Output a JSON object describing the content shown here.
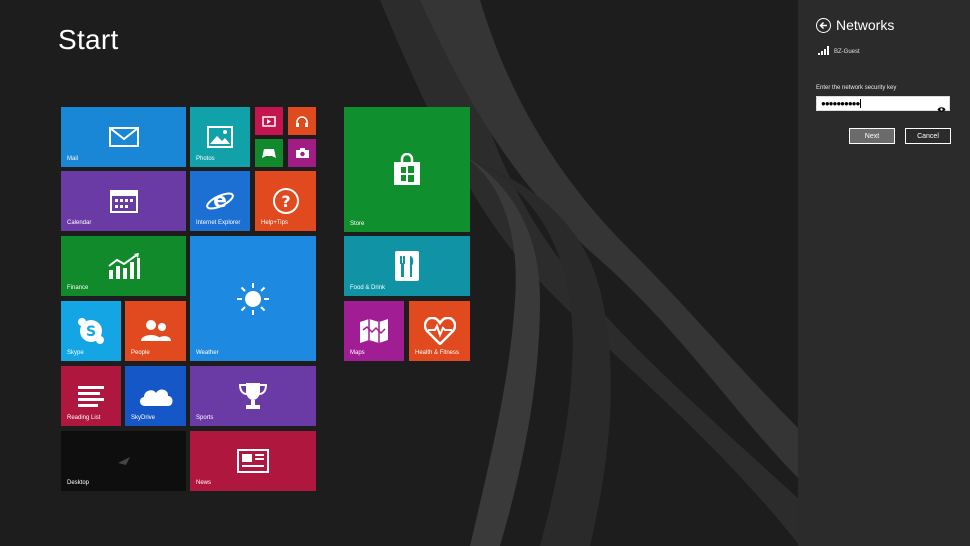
{
  "start": {
    "title": "Start"
  },
  "tiles": {
    "mail": {
      "label": "Mail",
      "icon": "mail-icon",
      "color": "#1a87d6"
    },
    "photos": {
      "label": "Photos",
      "icon": "photos-icon",
      "color": "#11a1a8"
    },
    "video": {
      "label": "",
      "icon": "video-icon",
      "color": "#c4154f"
    },
    "music": {
      "label": "",
      "icon": "headphones-icon",
      "color": "#e04a1f"
    },
    "games": {
      "label": "",
      "icon": "game-controller-icon",
      "color": "#108a2a"
    },
    "camera": {
      "label": "",
      "icon": "camera-icon",
      "color": "#a11d83"
    },
    "calendar": {
      "label": "Calendar",
      "icon": "calendar-icon",
      "color": "#6a3aa5"
    },
    "ie": {
      "label": "Internet Explorer",
      "icon": "internet-explorer-icon",
      "color": "#1c6fd3"
    },
    "help": {
      "label": "Help+Tips",
      "icon": "help-icon",
      "color": "#e14a1f"
    },
    "finance": {
      "label": "Finance",
      "icon": "finance-chart-icon",
      "color": "#108a2a"
    },
    "weather": {
      "label": "Weather",
      "icon": "sun-icon",
      "color": "#1e89e0"
    },
    "skype": {
      "label": "Skype",
      "icon": "skype-icon",
      "color": "#14a6e4"
    },
    "people": {
      "label": "People",
      "icon": "people-icon",
      "color": "#e14a1f"
    },
    "reading": {
      "label": "Reading List",
      "icon": "reading-list-icon",
      "color": "#b0173f"
    },
    "skydrive": {
      "label": "SkyDrive",
      "icon": "cloud-icon",
      "color": "#1657c8"
    },
    "sports": {
      "label": "Sports",
      "icon": "trophy-icon",
      "color": "#6a3aa5"
    },
    "desktop": {
      "label": "Desktop",
      "icon": "desktop-icon",
      "color": "#0e0e0e"
    },
    "news": {
      "label": "News",
      "icon": "newspaper-icon",
      "color": "#b0173f"
    },
    "store": {
      "label": "Store",
      "icon": "store-bag-icon",
      "color": "#0f8f2d"
    },
    "food": {
      "label": "Food & Drink",
      "icon": "food-icon",
      "color": "#1094a5"
    },
    "maps": {
      "label": "Maps",
      "icon": "map-icon",
      "color": "#a11d94"
    },
    "health": {
      "label": "Health & Fitness",
      "icon": "heart-icon",
      "color": "#e14a1f"
    }
  },
  "charm": {
    "title": "Networks",
    "network_name": "BZ-Guest",
    "key_label": "Enter the network security key",
    "key_value": "●●●●●●●●●●",
    "next_label": "Next",
    "cancel_label": "Cancel"
  }
}
